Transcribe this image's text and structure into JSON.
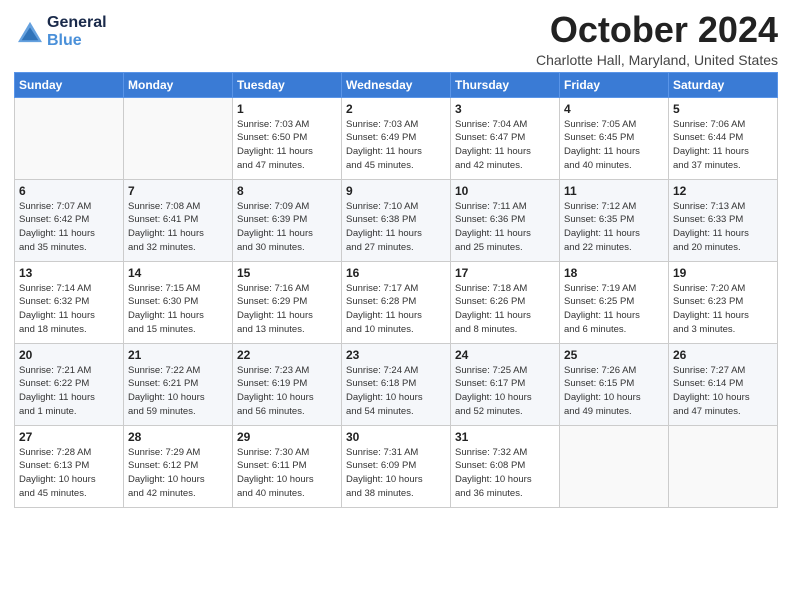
{
  "logo": {
    "line1": "General",
    "line2": "Blue"
  },
  "title": "October 2024",
  "location": "Charlotte Hall, Maryland, United States",
  "days_of_week": [
    "Sunday",
    "Monday",
    "Tuesday",
    "Wednesday",
    "Thursday",
    "Friday",
    "Saturday"
  ],
  "weeks": [
    [
      {
        "day": "",
        "detail": ""
      },
      {
        "day": "",
        "detail": ""
      },
      {
        "day": "1",
        "detail": "Sunrise: 7:03 AM\nSunset: 6:50 PM\nDaylight: 11 hours\nand 47 minutes."
      },
      {
        "day": "2",
        "detail": "Sunrise: 7:03 AM\nSunset: 6:49 PM\nDaylight: 11 hours\nand 45 minutes."
      },
      {
        "day": "3",
        "detail": "Sunrise: 7:04 AM\nSunset: 6:47 PM\nDaylight: 11 hours\nand 42 minutes."
      },
      {
        "day": "4",
        "detail": "Sunrise: 7:05 AM\nSunset: 6:45 PM\nDaylight: 11 hours\nand 40 minutes."
      },
      {
        "day": "5",
        "detail": "Sunrise: 7:06 AM\nSunset: 6:44 PM\nDaylight: 11 hours\nand 37 minutes."
      }
    ],
    [
      {
        "day": "6",
        "detail": "Sunrise: 7:07 AM\nSunset: 6:42 PM\nDaylight: 11 hours\nand 35 minutes."
      },
      {
        "day": "7",
        "detail": "Sunrise: 7:08 AM\nSunset: 6:41 PM\nDaylight: 11 hours\nand 32 minutes."
      },
      {
        "day": "8",
        "detail": "Sunrise: 7:09 AM\nSunset: 6:39 PM\nDaylight: 11 hours\nand 30 minutes."
      },
      {
        "day": "9",
        "detail": "Sunrise: 7:10 AM\nSunset: 6:38 PM\nDaylight: 11 hours\nand 27 minutes."
      },
      {
        "day": "10",
        "detail": "Sunrise: 7:11 AM\nSunset: 6:36 PM\nDaylight: 11 hours\nand 25 minutes."
      },
      {
        "day": "11",
        "detail": "Sunrise: 7:12 AM\nSunset: 6:35 PM\nDaylight: 11 hours\nand 22 minutes."
      },
      {
        "day": "12",
        "detail": "Sunrise: 7:13 AM\nSunset: 6:33 PM\nDaylight: 11 hours\nand 20 minutes."
      }
    ],
    [
      {
        "day": "13",
        "detail": "Sunrise: 7:14 AM\nSunset: 6:32 PM\nDaylight: 11 hours\nand 18 minutes."
      },
      {
        "day": "14",
        "detail": "Sunrise: 7:15 AM\nSunset: 6:30 PM\nDaylight: 11 hours\nand 15 minutes."
      },
      {
        "day": "15",
        "detail": "Sunrise: 7:16 AM\nSunset: 6:29 PM\nDaylight: 11 hours\nand 13 minutes."
      },
      {
        "day": "16",
        "detail": "Sunrise: 7:17 AM\nSunset: 6:28 PM\nDaylight: 11 hours\nand 10 minutes."
      },
      {
        "day": "17",
        "detail": "Sunrise: 7:18 AM\nSunset: 6:26 PM\nDaylight: 11 hours\nand 8 minutes."
      },
      {
        "day": "18",
        "detail": "Sunrise: 7:19 AM\nSunset: 6:25 PM\nDaylight: 11 hours\nand 6 minutes."
      },
      {
        "day": "19",
        "detail": "Sunrise: 7:20 AM\nSunset: 6:23 PM\nDaylight: 11 hours\nand 3 minutes."
      }
    ],
    [
      {
        "day": "20",
        "detail": "Sunrise: 7:21 AM\nSunset: 6:22 PM\nDaylight: 11 hours\nand 1 minute."
      },
      {
        "day": "21",
        "detail": "Sunrise: 7:22 AM\nSunset: 6:21 PM\nDaylight: 10 hours\nand 59 minutes."
      },
      {
        "day": "22",
        "detail": "Sunrise: 7:23 AM\nSunset: 6:19 PM\nDaylight: 10 hours\nand 56 minutes."
      },
      {
        "day": "23",
        "detail": "Sunrise: 7:24 AM\nSunset: 6:18 PM\nDaylight: 10 hours\nand 54 minutes."
      },
      {
        "day": "24",
        "detail": "Sunrise: 7:25 AM\nSunset: 6:17 PM\nDaylight: 10 hours\nand 52 minutes."
      },
      {
        "day": "25",
        "detail": "Sunrise: 7:26 AM\nSunset: 6:15 PM\nDaylight: 10 hours\nand 49 minutes."
      },
      {
        "day": "26",
        "detail": "Sunrise: 7:27 AM\nSunset: 6:14 PM\nDaylight: 10 hours\nand 47 minutes."
      }
    ],
    [
      {
        "day": "27",
        "detail": "Sunrise: 7:28 AM\nSunset: 6:13 PM\nDaylight: 10 hours\nand 45 minutes."
      },
      {
        "day": "28",
        "detail": "Sunrise: 7:29 AM\nSunset: 6:12 PM\nDaylight: 10 hours\nand 42 minutes."
      },
      {
        "day": "29",
        "detail": "Sunrise: 7:30 AM\nSunset: 6:11 PM\nDaylight: 10 hours\nand 40 minutes."
      },
      {
        "day": "30",
        "detail": "Sunrise: 7:31 AM\nSunset: 6:09 PM\nDaylight: 10 hours\nand 38 minutes."
      },
      {
        "day": "31",
        "detail": "Sunrise: 7:32 AM\nSunset: 6:08 PM\nDaylight: 10 hours\nand 36 minutes."
      },
      {
        "day": "",
        "detail": ""
      },
      {
        "day": "",
        "detail": ""
      }
    ]
  ]
}
